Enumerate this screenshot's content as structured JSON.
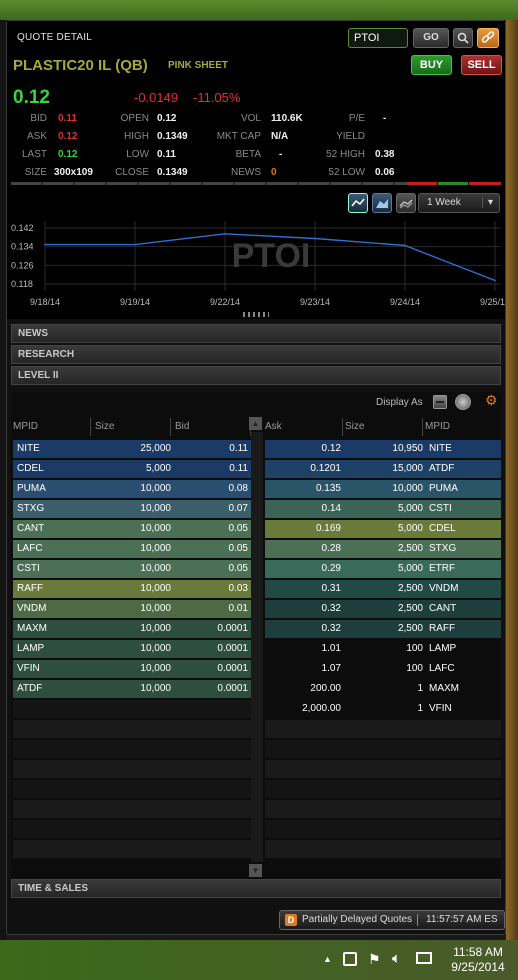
{
  "header": {
    "title": "QUOTE DETAIL",
    "symbol_value": "PTOI",
    "go_label": "GO",
    "buy_label": "BUY",
    "sell_label": "SELL",
    "company": "PLASTIC20 IL (QB)",
    "market": "PINK SHEET",
    "price": "0.12",
    "change": "-0.0149",
    "change_pct": "-11.05%"
  },
  "stats": {
    "bid_label": "BID",
    "bid": "0.11",
    "ask_label": "ASK",
    "ask": "0.12",
    "last_label": "LAST",
    "last": "0.12",
    "size_label": "SIZE",
    "size": "300x109",
    "open_label": "OPEN",
    "open": "0.12",
    "high_label": "HIGH",
    "high": "0.1349",
    "low_label": "LOW",
    "low": "0.11",
    "close_label": "CLOSE",
    "close": "0.1349",
    "vol_label": "VOL",
    "vol": "110.6K",
    "mktcap_label": "MKT CAP",
    "mktcap": "N/A",
    "beta_label": "BETA",
    "beta": "-",
    "news_label": "NEWS",
    "news": "0",
    "pe_label": "P/E",
    "pe": "-",
    "yield_label": "YIELD",
    "yield": "",
    "high52_label": "52 HIGH",
    "high52": "0.38",
    "low52_label": "52 LOW",
    "low52": "0.06"
  },
  "chart_toolbar": {
    "range": "1 Week"
  },
  "chart_data": {
    "type": "line",
    "title": "PTOI",
    "x": [
      "9/18/14",
      "9/19/14",
      "9/22/14",
      "9/23/14",
      "9/24/14",
      "9/25/14"
    ],
    "series": [
      {
        "values": [
          0.1349,
          0.1349,
          0.1395,
          0.1375,
          0.1345,
          0.1195
        ]
      }
    ],
    "yticks": [
      "0.142",
      "0.134",
      "0.126",
      "0.118"
    ],
    "ylim": [
      0.115,
      0.145
    ],
    "grid": true,
    "line_color": "#2e6ed6"
  },
  "sections": {
    "news": "NEWS",
    "research": "RESEARCH",
    "level2": "LEVEL II",
    "time_sales": "TIME & SALES"
  },
  "level2": {
    "display_as": "Display As",
    "columns": {
      "mpid": "MPID",
      "size": "Size",
      "bid": "Bid",
      "ask": "Ask",
      "size2": "Size",
      "mpid2": "MPID"
    },
    "bids": [
      {
        "mpid": "NITE",
        "size": "25,000",
        "bid": "0.11",
        "color": "#1c3a66"
      },
      {
        "mpid": "CDEL",
        "size": "5,000",
        "bid": "0.11",
        "color": "#1c3a66"
      },
      {
        "mpid": "PUMA",
        "size": "10,000",
        "bid": "0.08",
        "color": "#2a4e72"
      },
      {
        "mpid": "STXG",
        "size": "10,000",
        "bid": "0.07",
        "color": "#3a5e6c"
      },
      {
        "mpid": "CANT",
        "size": "10,000",
        "bid": "0.05",
        "color": "#4c7056"
      },
      {
        "mpid": "LAFC",
        "size": "10,000",
        "bid": "0.05",
        "color": "#4c7056"
      },
      {
        "mpid": "CSTI",
        "size": "10,000",
        "bid": "0.05",
        "color": "#4c7056"
      },
      {
        "mpid": "RAFF",
        "size": "10,000",
        "bid": "0.03",
        "color": "#6a7a3a"
      },
      {
        "mpid": "VNDM",
        "size": "10,000",
        "bid": "0.01",
        "color": "#4e6a44"
      },
      {
        "mpid": "MAXM",
        "size": "10,000",
        "bid": "0.0001",
        "color": "#2e4e40"
      },
      {
        "mpid": "LAMP",
        "size": "10,000",
        "bid": "0.0001",
        "color": "#2e4e40"
      },
      {
        "mpid": "VFIN",
        "size": "10,000",
        "bid": "0.0001",
        "color": "#2e4e40"
      },
      {
        "mpid": "ATDF",
        "size": "10,000",
        "bid": "0.0001",
        "color": "#2e4e40"
      }
    ],
    "asks": [
      {
        "ask": "0.12",
        "size": "10,950",
        "mpid": "NITE",
        "color": "#1c3a66"
      },
      {
        "ask": "0.1201",
        "size": "15,000",
        "mpid": "ATDF",
        "color": "#1e4266"
      },
      {
        "ask": "0.135",
        "size": "10,000",
        "mpid": "PUMA",
        "color": "#2a5468"
      },
      {
        "ask": "0.14",
        "size": "5,000",
        "mpid": "CSTI",
        "color": "#3c6456"
      },
      {
        "ask": "0.169",
        "size": "5,000",
        "mpid": "CDEL",
        "color": "#6a7a3a"
      },
      {
        "ask": "0.28",
        "size": "2,500",
        "mpid": "STXG",
        "color": "#4c7056"
      },
      {
        "ask": "0.29",
        "size": "5,000",
        "mpid": "ETRF",
        "color": "#3a6a5a"
      },
      {
        "ask": "0.31",
        "size": "2,500",
        "mpid": "VNDM",
        "color": "#224a44"
      },
      {
        "ask": "0.32",
        "size": "2,500",
        "mpid": "CANT",
        "color": "#1e3e3e"
      },
      {
        "ask": "0.32",
        "size": "2,500",
        "mpid": "RAFF",
        "color": "#1e3e3e"
      },
      {
        "ask": "1.01",
        "size": "100",
        "mpid": "LAMP",
        "color": "#0c0c0c"
      },
      {
        "ask": "1.07",
        "size": "100",
        "mpid": "LAFC",
        "color": "#0c0c0c"
      },
      {
        "ask": "200.00",
        "size": "1",
        "mpid": "MAXM",
        "color": "#0c0c0c"
      },
      {
        "ask": "2,000.00",
        "size": "1",
        "mpid": "VFIN",
        "color": "#0c0c0c"
      }
    ]
  },
  "status": {
    "delayed_badge": "D",
    "delayed_text": "Partially Delayed Quotes",
    "time": "11:57:57 AM ES"
  },
  "taskbar": {
    "clock_time": "11:58 AM",
    "clock_date": "9/25/2014"
  }
}
